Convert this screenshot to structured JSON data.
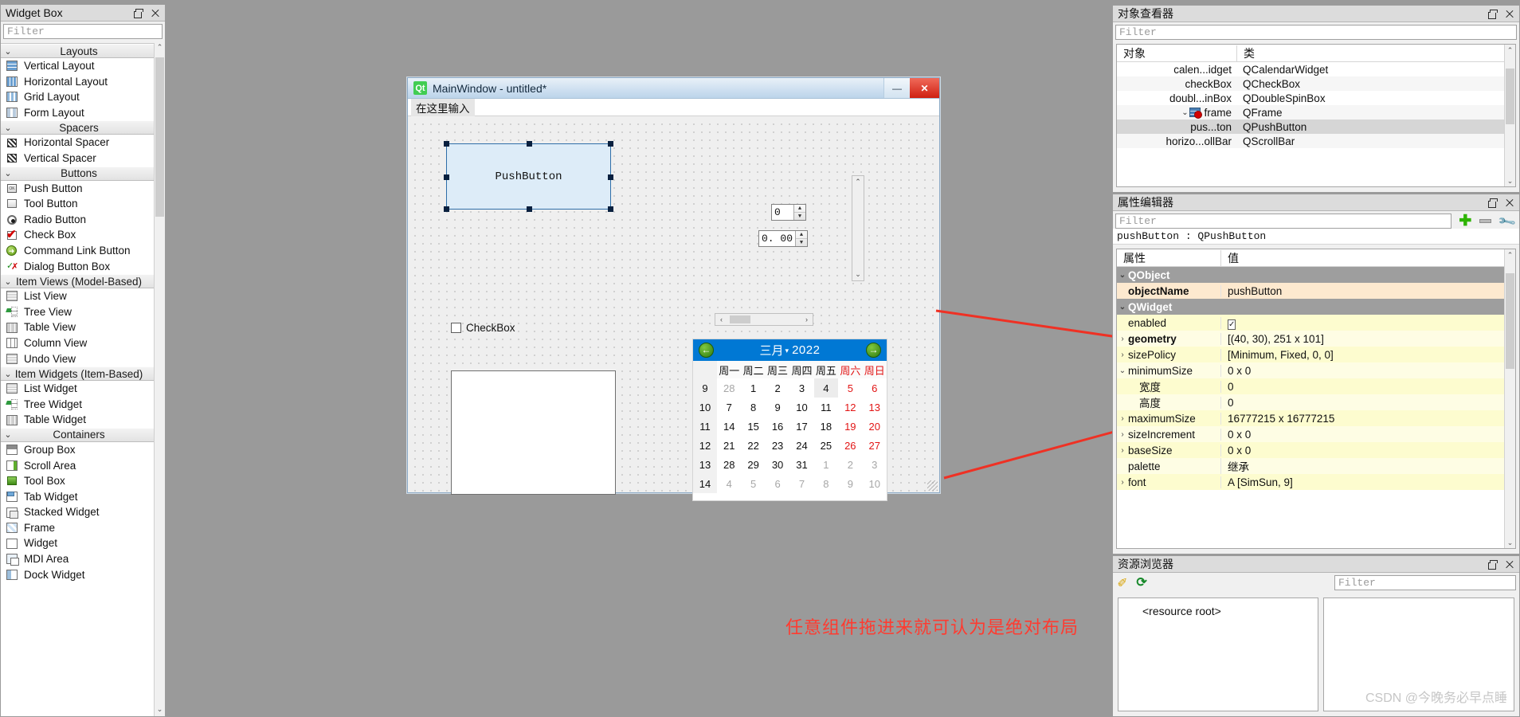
{
  "widget_box": {
    "title": "Widget Box",
    "filter_placeholder": "Filter",
    "groups": [
      {
        "name": "Layouts",
        "items": [
          {
            "label": "Vertical Layout",
            "icon": "vertical-layout-icon"
          },
          {
            "label": "Horizontal Layout",
            "icon": "horizontal-layout-icon"
          },
          {
            "label": "Grid Layout",
            "icon": "grid-layout-icon"
          },
          {
            "label": "Form Layout",
            "icon": "form-layout-icon"
          }
        ]
      },
      {
        "name": "Spacers",
        "items": [
          {
            "label": "Horizontal Spacer",
            "icon": "horizontal-spacer-icon"
          },
          {
            "label": "Vertical Spacer",
            "icon": "vertical-spacer-icon"
          }
        ]
      },
      {
        "name": "Buttons",
        "items": [
          {
            "label": "Push Button",
            "icon": "push-button-icon"
          },
          {
            "label": "Tool Button",
            "icon": "tool-button-icon"
          },
          {
            "label": "Radio Button",
            "icon": "radio-button-icon"
          },
          {
            "label": "Check Box",
            "icon": "check-box-icon"
          },
          {
            "label": "Command Link Button",
            "icon": "command-link-icon"
          },
          {
            "label": "Dialog Button Box",
            "icon": "dialog-button-box-icon"
          }
        ]
      },
      {
        "name": "Item Views (Model-Based)",
        "items": [
          {
            "label": "List View",
            "icon": "list-view-icon"
          },
          {
            "label": "Tree View",
            "icon": "tree-view-icon"
          },
          {
            "label": "Table View",
            "icon": "table-view-icon"
          },
          {
            "label": "Column View",
            "icon": "column-view-icon"
          },
          {
            "label": "Undo View",
            "icon": "undo-view-icon"
          }
        ]
      },
      {
        "name": "Item Widgets (Item-Based)",
        "items": [
          {
            "label": "List Widget",
            "icon": "list-widget-icon"
          },
          {
            "label": "Tree Widget",
            "icon": "tree-widget-icon"
          },
          {
            "label": "Table Widget",
            "icon": "table-widget-icon"
          }
        ]
      },
      {
        "name": "Containers",
        "items": [
          {
            "label": "Group Box",
            "icon": "group-box-icon"
          },
          {
            "label": "Scroll Area",
            "icon": "scroll-area-icon"
          },
          {
            "label": "Tool Box",
            "icon": "tool-box-icon"
          },
          {
            "label": "Tab Widget",
            "icon": "tab-widget-icon"
          },
          {
            "label": "Stacked Widget",
            "icon": "stacked-widget-icon"
          },
          {
            "label": "Frame",
            "icon": "frame-icon"
          },
          {
            "label": "Widget",
            "icon": "widget-icon"
          },
          {
            "label": "MDI Area",
            "icon": "mdi-area-icon"
          },
          {
            "label": "Dock Widget",
            "icon": "dock-widget-icon"
          }
        ]
      }
    ]
  },
  "form": {
    "title": "MainWindow - untitled*",
    "logo_text": "Qt",
    "menu_placeholder": "在这里输入",
    "minimize_glyph": "—",
    "close_glyph": "✕",
    "push_button_label": "PushButton",
    "spin_value": "0",
    "double_spin_value": "0. 00",
    "checkbox_label": "CheckBox",
    "scroll_up": "⌃",
    "scroll_down": "⌄",
    "scroll_left": "‹",
    "scroll_right": "›"
  },
  "calendar": {
    "prev_glyph": "←",
    "next_glyph": "→",
    "month": "三月",
    "year": "2022",
    "day_headers": [
      "周一",
      "周二",
      "周三",
      "周四",
      "周五",
      "周六",
      "周日"
    ],
    "weeks": [
      {
        "number": "9",
        "days": [
          "28",
          "1",
          "2",
          "3",
          "4",
          "5",
          "6"
        ],
        "out": [
          0
        ],
        "selected": 4
      },
      {
        "number": "10",
        "days": [
          "7",
          "8",
          "9",
          "10",
          "11",
          "12",
          "13"
        ],
        "out": []
      },
      {
        "number": "11",
        "days": [
          "14",
          "15",
          "16",
          "17",
          "18",
          "19",
          "20"
        ],
        "out": []
      },
      {
        "number": "12",
        "days": [
          "21",
          "22",
          "23",
          "24",
          "25",
          "26",
          "27"
        ],
        "out": []
      },
      {
        "number": "13",
        "days": [
          "28",
          "29",
          "30",
          "31",
          "1",
          "2",
          "3"
        ],
        "out": [
          4,
          5,
          6
        ]
      },
      {
        "number": "14",
        "days": [
          "4",
          "5",
          "6",
          "7",
          "8",
          "9",
          "10"
        ],
        "out": [
          0,
          1,
          2,
          3,
          4,
          5,
          6
        ]
      }
    ]
  },
  "annotation": {
    "text": "任意组件拖进来就可认为是绝对布局",
    "color": "#ff3b30"
  },
  "object_inspector": {
    "title": "对象查看器",
    "filter_placeholder": "Filter",
    "col_object": "对象",
    "col_class": "类",
    "rows": [
      {
        "name": "calen...idget",
        "class": "QCalendarWidget",
        "indent": 2,
        "expand": "",
        "selected": false
      },
      {
        "name": "checkBox",
        "class": "QCheckBox",
        "indent": 2,
        "expand": "",
        "selected": false
      },
      {
        "name": "doubl...inBox",
        "class": "QDoubleSpinBox",
        "indent": 2,
        "expand": "",
        "selected": false
      },
      {
        "name": "frame",
        "class": "QFrame",
        "indent": 1,
        "expand": "⌄",
        "selected": false
      },
      {
        "name": "pus...ton",
        "class": "QPushButton",
        "indent": 3,
        "expand": "",
        "selected": true
      },
      {
        "name": "horizo...ollBar",
        "class": "QScrollBar",
        "indent": 2,
        "expand": "",
        "selected": false
      }
    ]
  },
  "property_editor": {
    "title": "属性编辑器",
    "filter_placeholder": "Filter",
    "target": "pushButton : QPushButton",
    "col_property": "属性",
    "col_value": "值",
    "rows": [
      {
        "kind": "group",
        "name": "QObject",
        "value": "",
        "expand": "⌄"
      },
      {
        "kind": "obj",
        "name": "objectName",
        "value": "pushButton",
        "expand": ""
      },
      {
        "kind": "group",
        "name": "QWidget",
        "value": "",
        "expand": "⌄"
      },
      {
        "kind": "yel",
        "name": "enabled",
        "value": "☑",
        "checkbox": true,
        "expand": ""
      },
      {
        "kind": "yel2",
        "name": "geometry",
        "value": "[(40, 30), 251 x 101]",
        "expand": "›",
        "bold": true
      },
      {
        "kind": "yel",
        "name": "sizePolicy",
        "value": "[Minimum, Fixed, 0, 0]",
        "expand": "›"
      },
      {
        "kind": "yel2",
        "name": "minimumSize",
        "value": "0 x 0",
        "expand": "⌄"
      },
      {
        "kind": "yel",
        "name": "宽度",
        "value": "0",
        "expand": "",
        "sub": true
      },
      {
        "kind": "yel2",
        "name": "高度",
        "value": "0",
        "expand": "",
        "sub": true
      },
      {
        "kind": "yel",
        "name": "maximumSize",
        "value": "16777215 x 16777215",
        "expand": "›"
      },
      {
        "kind": "yel2",
        "name": "sizeIncrement",
        "value": "0 x 0",
        "expand": "›"
      },
      {
        "kind": "yel",
        "name": "baseSize",
        "value": "0 x 0",
        "expand": "›"
      },
      {
        "kind": "yel2",
        "name": "palette",
        "value": "继承",
        "expand": ""
      },
      {
        "kind": "yel",
        "name": "font",
        "value": "A  [SimSun, 9]",
        "expand": "›"
      }
    ]
  },
  "resource_browser": {
    "title": "资源浏览器",
    "filter_placeholder": "Filter",
    "root_label": "<resource root>",
    "watermark": "CSDN @今晚务必早点睡"
  }
}
